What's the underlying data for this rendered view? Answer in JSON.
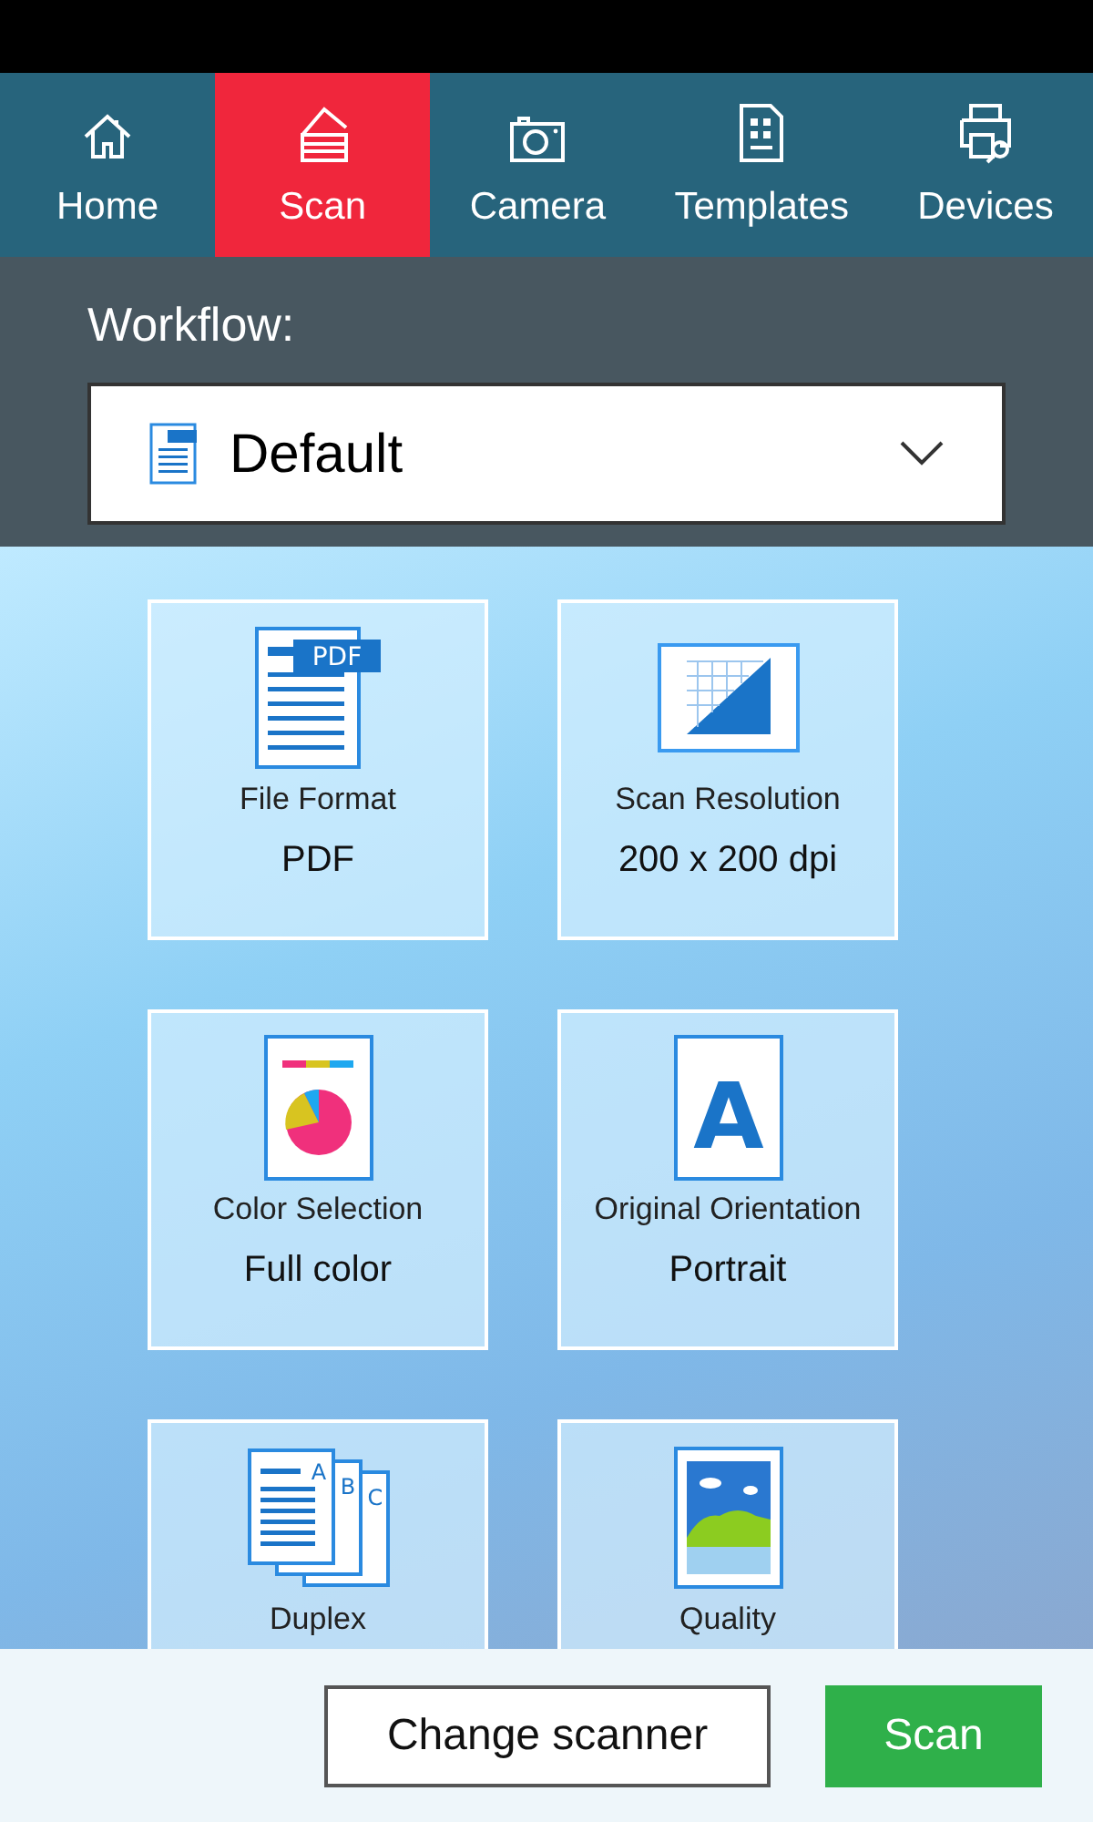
{
  "tabs": [
    {
      "kind": "home",
      "label": "Home",
      "selected": false
    },
    {
      "kind": "scan",
      "label": "Scan",
      "selected": true
    },
    {
      "kind": "camera",
      "label": "Camera",
      "selected": false
    },
    {
      "kind": "templates",
      "label": "Templates",
      "selected": false
    },
    {
      "kind": "devices",
      "label": "Devices",
      "selected": false
    }
  ],
  "workflow": {
    "label": "Workflow:",
    "value": "Default"
  },
  "tiles": [
    {
      "kind": "format",
      "title": "File Format",
      "value": "PDF",
      "icon_text": [
        "PDF"
      ]
    },
    {
      "kind": "resolution",
      "title": "Scan Resolution",
      "value": "200 x 200 dpi"
    },
    {
      "kind": "color",
      "title": "Color Selection",
      "value": "Full color"
    },
    {
      "kind": "orientation",
      "title": "Original Orientation",
      "value": "Portrait",
      "icon_text": [
        "A"
      ]
    },
    {
      "kind": "duplex",
      "title": "Duplex",
      "icon_text": [
        "A",
        "B",
        "C"
      ]
    },
    {
      "kind": "quality",
      "title": "Quality"
    }
  ],
  "buttons": [
    {
      "kind": "secondary",
      "label": "Change scanner"
    },
    {
      "kind": "primary",
      "label": "Scan"
    }
  ]
}
